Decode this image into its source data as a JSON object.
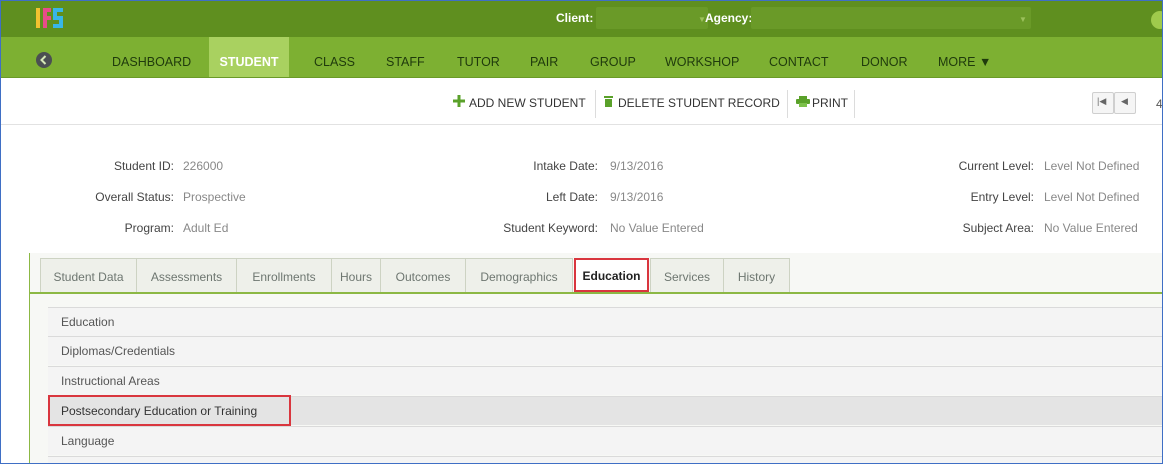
{
  "header": {
    "client_label": "Client:",
    "agency_label": "Agency:",
    "colors": {
      "top": "#5f8f1f",
      "nav": "#7db032",
      "active_tab": "#a9d160",
      "highlight": "#d9363e"
    }
  },
  "nav": {
    "items": [
      "DASHBOARD",
      "STUDENT",
      "CLASS",
      "STAFF",
      "TUTOR",
      "PAIR",
      "GROUP",
      "WORKSHOP",
      "CONTACT",
      "DONOR",
      "MORE ▼"
    ],
    "active": "STUDENT"
  },
  "toolbar": {
    "add_label": "ADD NEW STUDENT",
    "delete_label": "DELETE STUDENT RECORD",
    "print_label": "PRINT",
    "pager_first": "|◀",
    "pager_prev": "◀",
    "pager_number": "4"
  },
  "student": {
    "id_label": "Student ID:",
    "id_value": "226000",
    "status_label": "Overall Status:",
    "status_value": "Prospective",
    "program_label": "Program:",
    "program_value": "Adult Ed",
    "intake_label": "Intake Date:",
    "intake_value": "9/13/2016",
    "left_label": "Left Date:",
    "left_value": "9/13/2016",
    "keyword_label": "Student Keyword:",
    "keyword_value": "No Value Entered",
    "current_label": "Current Level:",
    "current_value": "Level Not Defined",
    "entry_label": "Entry Level:",
    "entry_value": "Level Not Defined",
    "subject_label": "Subject Area:",
    "subject_value": "No Value Entered"
  },
  "tabs": [
    "Student Data",
    "Assessments",
    "Enrollments",
    "Hours",
    "Outcomes",
    "Demographics",
    "Education",
    "Services",
    "History"
  ],
  "active_tab": "Education",
  "education_sections": [
    "Education",
    "Diplomas/Credentials",
    "Instructional Areas",
    "Postsecondary Education or Training",
    "Language"
  ],
  "selected_section": "Postsecondary Education or Training"
}
